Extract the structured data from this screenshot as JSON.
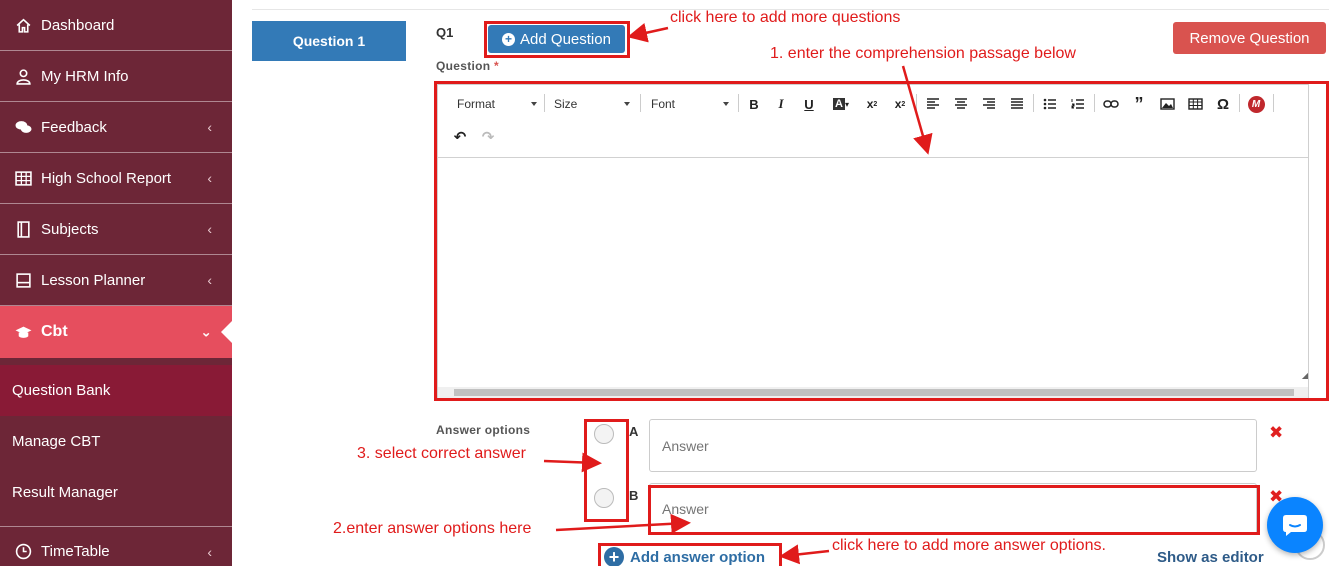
{
  "sidebar": {
    "items": [
      {
        "label": "Dashboard",
        "icon": "home-icon",
        "chevron": ""
      },
      {
        "label": "My HRM Info",
        "icon": "user-icon",
        "chevron": ""
      },
      {
        "label": "Feedback",
        "icon": "comments-icon",
        "chevron": "‹"
      },
      {
        "label": "High School Report",
        "icon": "table-icon",
        "chevron": "‹"
      },
      {
        "label": "Subjects",
        "icon": "book-icon",
        "chevron": "‹"
      },
      {
        "label": "Lesson Planner",
        "icon": "file-icon",
        "chevron": "‹"
      },
      {
        "label": "Cbt",
        "icon": "graduation-cap-icon",
        "chevron": "⌄"
      }
    ],
    "sub_items": [
      {
        "label": "Question Bank"
      },
      {
        "label": "Manage CBT"
      },
      {
        "label": "Result Manager"
      }
    ],
    "last_item": {
      "label": "TimeTable",
      "icon": "clock-icon",
      "chevron": "‹"
    }
  },
  "question": {
    "tab_label": "Question 1",
    "number": "Q1",
    "add_button": "Add Question",
    "remove_button": "Remove Question",
    "label": "Question",
    "required_mark": "*"
  },
  "editor": {
    "format_label": "Format",
    "size_label": "Size",
    "font_label": "Font"
  },
  "answers": {
    "label": "Answer options",
    "options": [
      {
        "letter": "A",
        "placeholder": "Answer"
      },
      {
        "letter": "B",
        "placeholder": "Answer"
      }
    ],
    "add_option": "Add answer option",
    "show_as_editor": "Show as editor"
  },
  "annotations": {
    "add_questions": "click here to add more questions",
    "passage": "1. enter the comprehension passage below",
    "correct": "3. select correct answer",
    "options": "2.enter answer options here",
    "add_options": "click here to add more answer options."
  },
  "colors": {
    "sidebar": "#6d2637",
    "active": "#e64e5e",
    "selected_sub": "#891a36",
    "primary": "#337ab7",
    "danger": "#d9534f",
    "annotation": "#e01b1b"
  }
}
